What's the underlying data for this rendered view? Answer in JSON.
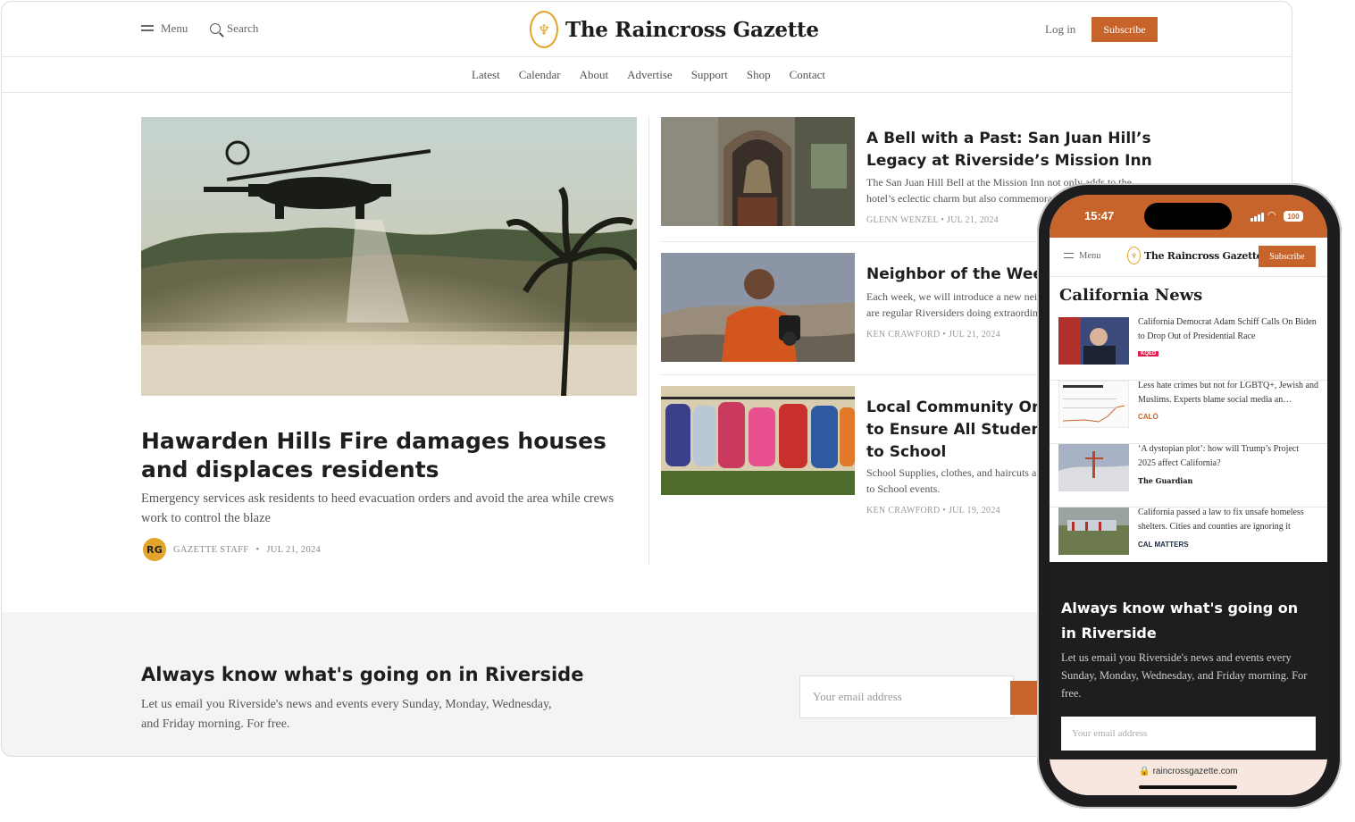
{
  "site": {
    "logo_text": "The Raincross Gazette",
    "logo_glyph": "♆"
  },
  "header": {
    "menu_label": "Menu",
    "search_label": "Search",
    "login_label": "Log in",
    "subscribe_label": "Subscribe"
  },
  "nav": [
    "Latest",
    "Calendar",
    "About",
    "Advertise",
    "Support",
    "Shop",
    "Contact"
  ],
  "hero": {
    "title": "Hawarden Hills Fire damages houses and displaces residents",
    "dek": "Emergency services ask residents to heed evacuation orders and avoid the area while crews work to control the blaze",
    "author": "GAZETTE STAFF",
    "separator": "•",
    "date": "JUL 21, 2024",
    "avatar_text": "RG"
  },
  "stories": [
    {
      "title": "A Bell with a Past: San Juan Hill’s Legacy at Riverside’s Mission Inn",
      "dek": "The San Juan Hill Bell at the Mission Inn not only adds to the hotel’s eclectic charm but also commemorates a significant",
      "author": "GLENN WENZEL",
      "date": "JUL 21, 2024"
    },
    {
      "title": "Neighbor of the Week: Shawn",
      "dek": "Each week, we will introduce a new neighbor to our list. These are regular Riversiders doing extraordinary",
      "author": "KEN CRAWFORD",
      "date": "JUL 21, 2024"
    },
    {
      "title": "Local Community Organizations to Ensure All Students Go Back to School",
      "dek": "School Supplies, clothes, and haircuts are available at these Back to School events.",
      "author": "KEN CRAWFORD",
      "date": "JUL 19, 2024"
    }
  ],
  "newsletter": {
    "title": "Always know what's going on in Riverside",
    "dek": "Let us email you Riverside's news and events every Sunday, Monday, Wednesday, and Friday morning. For free.",
    "placeholder": "Your email address"
  },
  "phone": {
    "time": "15:47",
    "battery": "100",
    "section_title": "California News",
    "items": [
      {
        "headline": "California Democrat Adam Schiff Calls On Biden to Drop Out of Presidential Race",
        "source": "KQED"
      },
      {
        "headline": "Less hate crimes but not for LGBTQ+, Jewish and Muslims. Experts blame social media an…",
        "source": "CALÖ"
      },
      {
        "headline": "‘A dystopian plot’: how will Trump’s Project 2025 affect California?",
        "source": "The Guardian"
      },
      {
        "headline": "California passed a law to fix unsafe homeless shelters. Cities and counties are ignoring it",
        "source": "CAL MATTERS"
      }
    ],
    "newsletter_title": "Always know what's going on in Riverside",
    "newsletter_dek": "Let us email you Riverside's news and events every Sunday, Monday, Wednesday, and Friday morning. For free.",
    "placeholder": "Your email address",
    "url": "🔒 raincrossgazette.com"
  },
  "colors": {
    "accent": "#c7642b",
    "logo_gold": "#e0a52a",
    "dark_band": "#1f1d1d"
  }
}
